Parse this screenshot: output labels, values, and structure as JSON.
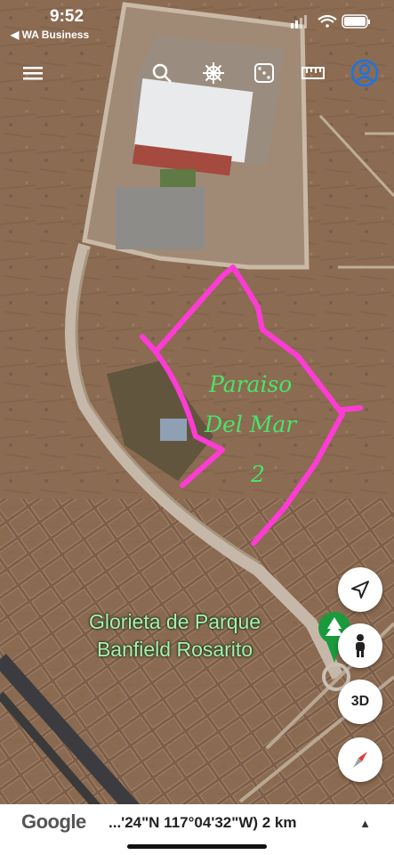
{
  "status_bar": {
    "time": "9:52",
    "back_app": "◀ WA Business"
  },
  "toolbar": {
    "icons": [
      "menu-icon",
      "search-icon",
      "ship-wheel-icon",
      "dice-icon",
      "ruler-icon",
      "account-icon"
    ]
  },
  "map": {
    "place_label_line1": "Glorieta de Parque",
    "place_label_line2": "Banfield Rosarito",
    "annotation_line1": "Paraiso",
    "annotation_line2": "Del Mar",
    "annotation_line3": "2",
    "annotation_color": "#ff3bd5",
    "label_color": "#a9f0b0",
    "pin_color": "#1a9a3c"
  },
  "controls": {
    "three_d_label": "3D"
  },
  "bottom_bar": {
    "brand": "Google",
    "coordinates": "...'24\"N 117°04'32\"W) 2 km"
  }
}
